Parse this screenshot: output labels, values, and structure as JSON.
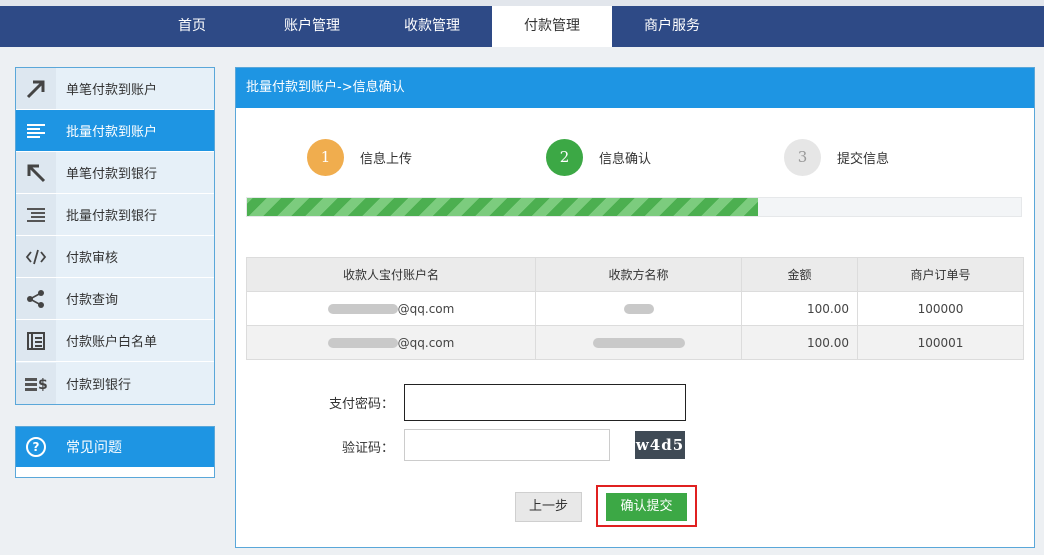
{
  "nav": {
    "items": [
      "首页",
      "账户管理",
      "收款管理",
      "付款管理",
      "商户服务"
    ],
    "active_index": 3
  },
  "sidebar": {
    "items": [
      {
        "label": "单笔付款到账户",
        "icon": "arrow-up-right-icon"
      },
      {
        "label": "批量付款到账户",
        "icon": "list-icon"
      },
      {
        "label": "单笔付款到银行",
        "icon": "arrow-up-left-icon"
      },
      {
        "label": "批量付款到银行",
        "icon": "list-indent-icon"
      },
      {
        "label": "付款审核",
        "icon": "code-icon"
      },
      {
        "label": "付款查询",
        "icon": "share-icon"
      },
      {
        "label": "付款账户白名单",
        "icon": "book-icon"
      },
      {
        "label": "付款到银行",
        "icon": "money-icon"
      }
    ],
    "active_index": 1
  },
  "faq": {
    "label": "常见问题",
    "icon": "question-circle-icon"
  },
  "panel": {
    "title": "批量付款到账户->信息确认"
  },
  "steps": [
    {
      "number": "1",
      "label": "信息上传",
      "color": "#f0ad4e"
    },
    {
      "number": "2",
      "label": "信息确认",
      "color": "#3ca845"
    },
    {
      "number": "3",
      "label": "提交信息",
      "color": "#e6e6e6"
    }
  ],
  "progress": {
    "fraction": 0.66
  },
  "table": {
    "headers": [
      "收款人宝付账户名",
      "收款方名称",
      "金额",
      "商户订单号"
    ],
    "rows": [
      {
        "account_suffix": "@qq.com",
        "amount": "100.00",
        "order_no": "100000"
      },
      {
        "account_suffix": "@qq.com",
        "amount": "100.00",
        "order_no": "100001"
      }
    ]
  },
  "form": {
    "password_label": "支付密码：",
    "password_value": "",
    "captcha_label": "验证码：",
    "captcha_value": "",
    "captcha_image_text": "w4d5"
  },
  "buttons": {
    "prev": "上一步",
    "submit": "确认提交"
  }
}
